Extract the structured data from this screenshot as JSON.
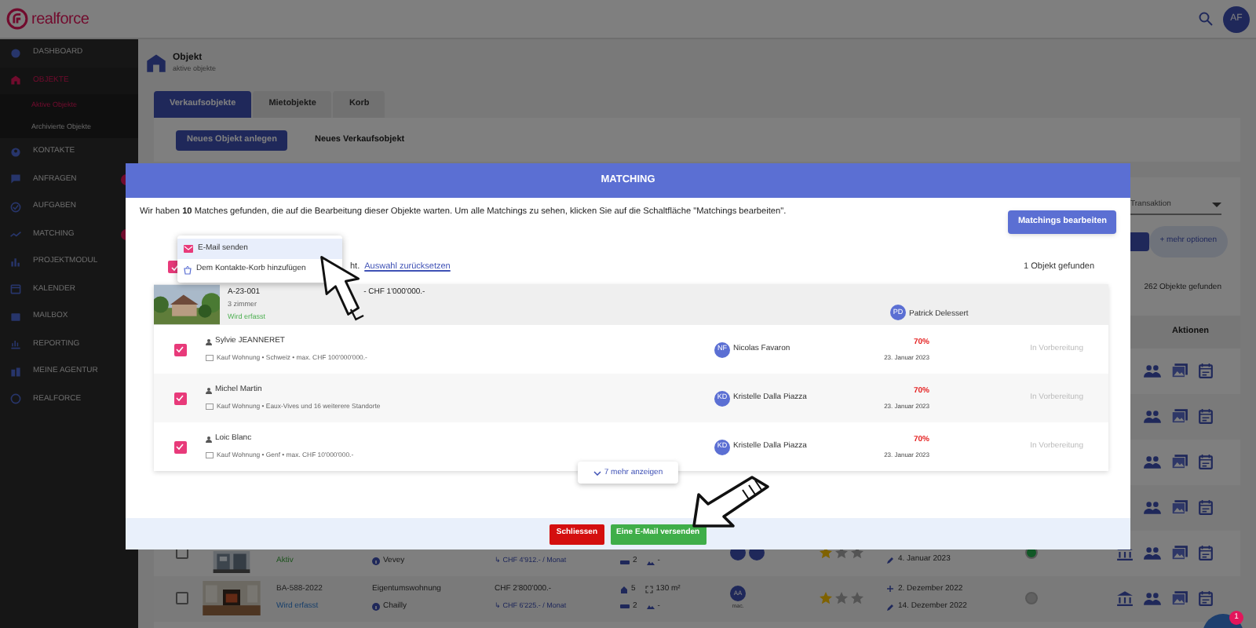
{
  "header": {
    "logo": "realforce",
    "avatar": "AF"
  },
  "sidebar": {
    "items": [
      {
        "label": "DASHBOARD",
        "selected": false,
        "badge": false
      },
      {
        "label": "OBJEKTE",
        "selected": true,
        "badge": false,
        "children": [
          {
            "label": "Aktive Objekte",
            "selected": true
          },
          {
            "label": "Archivierte Objekte",
            "selected": false
          }
        ]
      },
      {
        "label": "KONTAKTE",
        "selected": false,
        "badge": false
      },
      {
        "label": "ANFRAGEN",
        "selected": false,
        "badge": true
      },
      {
        "label": "AUFGABEN",
        "selected": false,
        "badge": false
      },
      {
        "label": "MATCHING",
        "selected": false,
        "badge": true
      },
      {
        "label": "PROJEKTMODUL",
        "selected": false,
        "badge": false
      },
      {
        "label": "KALENDER",
        "selected": false,
        "badge": false
      },
      {
        "label": "MAILBOX",
        "selected": false,
        "badge": false
      },
      {
        "label": "REPORTING",
        "selected": false,
        "badge": false
      },
      {
        "label": "MEINE AGENTUR",
        "selected": false,
        "badge": false
      },
      {
        "label": "REALFORCE",
        "selected": false,
        "badge": false
      }
    ]
  },
  "page": {
    "title": "Objekt",
    "subtitle": "aktive objekte"
  },
  "tabs": [
    {
      "label": "Verkaufsobjekte",
      "selected": true
    },
    {
      "label": "Mietobjekte",
      "selected": false
    },
    {
      "label": "Korb",
      "selected": false
    }
  ],
  "create": {
    "button": "Neues Objekt anlegen",
    "label": "Neues Verkaufsobjekt"
  },
  "filters": {
    "transaction": {
      "placeholder": "Transaktion"
    },
    "more_options": "+ mehr optionen",
    "result_count": "262 Objekte gefunden"
  },
  "table": {
    "actions_heading": "Aktionen",
    "rows": [
      {
        "kind": "covered"
      },
      {
        "kind": "covered"
      },
      {
        "kind": "covered"
      },
      {
        "kind": "covered"
      },
      {
        "kind": "active",
        "checked": false,
        "status": "Aktiv",
        "location": "Vevey",
        "monthly": "↳ CHF 4'912.- / Monat",
        "baths": "2",
        "extra": "-",
        "agents": [
          {
            "kind": "avatar"
          },
          {
            "kind": "avatar"
          }
        ],
        "stars": 1,
        "dates": [
          {
            "kind": "edited",
            "text": "4. Januar 2023"
          }
        ]
      },
      {
        "kind": "draft",
        "checked": false,
        "code": "BA-588-2022",
        "status": "Wird erfasst",
        "type": "Eigentumswohnung",
        "location": "Chailly",
        "price": "CHF 2'800'000.-",
        "monthly": "↳ CHF 6'225.- / Monat",
        "rooms": "5",
        "area": "130 m²",
        "baths": "2",
        "extra": "-",
        "agents": [
          {
            "kind": "avatar",
            "initials": "AA",
            "caption": "mac."
          }
        ],
        "stars": 1,
        "dates": [
          {
            "kind": "created",
            "text": "2. Dezember 2022"
          },
          {
            "kind": "edited",
            "text": "14. Dezember 2022"
          }
        ]
      }
    ]
  },
  "modal": {
    "title": "MATCHING",
    "intro": "Wir haben **10** Matches gefunden, die auf die Bearbeitung dieser Objekte warten. Um alle Matchings zu sehen, klicken Sie auf die Schaltfläche \"Matchings bearbeiten\".",
    "edit_button": "Matchings bearbeiten",
    "select_all": {
      "checked": true,
      "text_fragment": "ht.",
      "reset_link": "Auswahl zurücksetzen"
    },
    "found": "1 Objekt gefunden",
    "property": {
      "reference": "A-23-001",
      "summary": "- CHF 1'000'000.-",
      "rooms": "3 zimmer",
      "status": "Wird erfasst",
      "agent": {
        "initials": "PD",
        "name": "Patrick Delessert"
      }
    },
    "matches": [
      {
        "checked": true,
        "name": "Sylvie JEANNERET",
        "criteria": "Kauf Wohnung • Schweiz • max. CHF 100'000'000.-",
        "agent": {
          "initials": "NF",
          "name": "Nicolas Favaron"
        },
        "score": "70%",
        "date": "23. Januar 2023",
        "status": "In Vorbereitung"
      },
      {
        "checked": true,
        "name": "Michel Martin",
        "criteria": "Kauf Wohnung • Eaux-Vives und 16 weiterere Standorte",
        "agent": {
          "initials": "KD",
          "name": "Kristelle Dalla Piazza"
        },
        "score": "70%",
        "date": "23. Januar 2023",
        "status": "In Vorbereitung"
      },
      {
        "checked": true,
        "name": "Loic Blanc",
        "criteria": "Kauf Wohnung • Genf • max. CHF 10'000'000.-",
        "agent": {
          "initials": "KD",
          "name": "Kristelle Dalla Piazza"
        },
        "score": "70%",
        "date": "23. Januar 2023",
        "status": "In Vorbereitung"
      }
    ],
    "more_button": "7 mehr anzeigen",
    "close_button": "Schliessen",
    "send_button": "Eine E-Mail versenden",
    "menu": [
      {
        "label": "E-Mail senden",
        "selected": true
      },
      {
        "label": "Dem Kontakte-Korb hinzufügen",
        "selected": false
      }
    ]
  },
  "chat": {
    "badge": "1"
  }
}
